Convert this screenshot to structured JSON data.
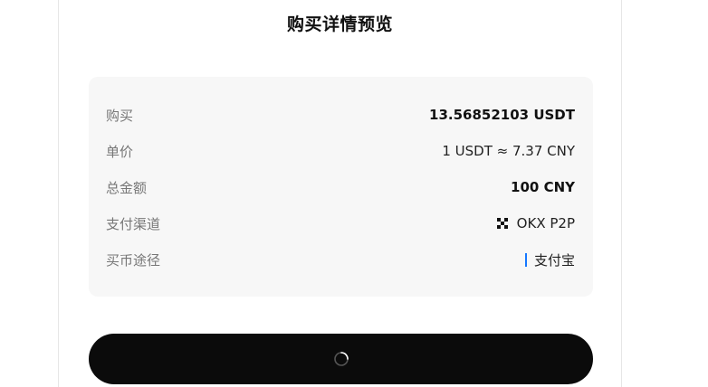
{
  "dialog": {
    "title": "购买详情预览"
  },
  "details": {
    "rows": [
      {
        "label": "购买",
        "value": "13.56852103 USDT"
      },
      {
        "label": "单价",
        "value": "1 USDT ≈ 7.37 CNY"
      },
      {
        "label": "总金额",
        "value": "100 CNY"
      },
      {
        "label": "支付渠道",
        "value": "OKX P2P",
        "icon": "okx-logo-icon"
      },
      {
        "label": "买币途径",
        "value": "支付宝",
        "icon": "alipay-bar-icon",
        "icon_color": "#1677ff"
      }
    ]
  },
  "confirm_button": {
    "state": "loading",
    "icon": "loading-spinner-icon",
    "background": "#0b0b0b"
  }
}
